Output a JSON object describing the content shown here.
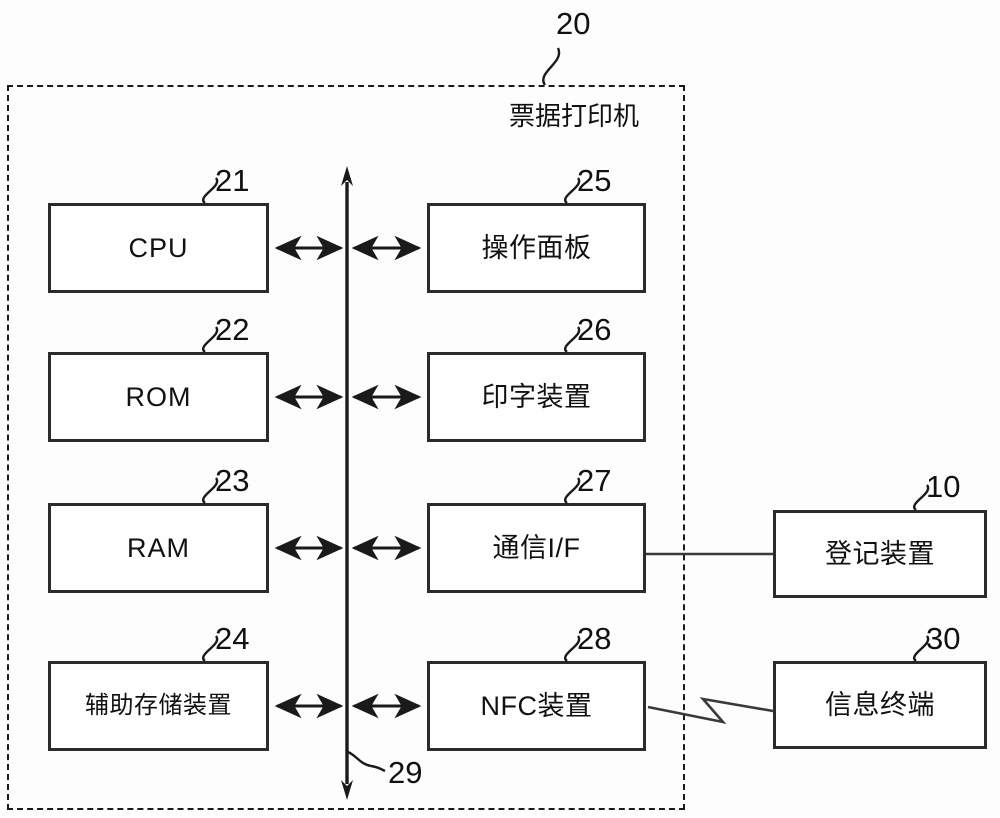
{
  "diagram": {
    "enclosure": {
      "title": "票据打印机",
      "ref": "20"
    },
    "bus": {
      "ref": "29"
    },
    "blocks": [
      {
        "id": "cpu",
        "label": "CPU",
        "ref": "21",
        "column": "left",
        "row": 1
      },
      {
        "id": "rom",
        "label": "ROM",
        "ref": "22",
        "column": "left",
        "row": 2
      },
      {
        "id": "ram",
        "label": "RAM",
        "ref": "23",
        "column": "left",
        "row": 3
      },
      {
        "id": "aux",
        "label": "辅助存储装置",
        "ref": "24",
        "column": "left",
        "row": 4
      },
      {
        "id": "panel",
        "label": "操作面板",
        "ref": "25",
        "column": "mid",
        "row": 1
      },
      {
        "id": "printer",
        "label": "印字装置",
        "ref": "26",
        "column": "mid",
        "row": 2
      },
      {
        "id": "commif",
        "label": "通信I/F",
        "ref": "27",
        "column": "mid",
        "row": 3
      },
      {
        "id": "nfc",
        "label": "NFC装置",
        "ref": "28",
        "column": "mid",
        "row": 4
      },
      {
        "id": "reg",
        "label": "登记装置",
        "ref": "10",
        "column": "right",
        "row": 3
      },
      {
        "id": "term",
        "label": "信息终端",
        "ref": "30",
        "column": "right",
        "row": 4
      }
    ],
    "connections": [
      {
        "from": "cpu",
        "to": "bus",
        "style": "double-arrow"
      },
      {
        "from": "bus",
        "to": "panel",
        "style": "double-arrow"
      },
      {
        "from": "rom",
        "to": "bus",
        "style": "double-arrow"
      },
      {
        "from": "bus",
        "to": "printer",
        "style": "double-arrow"
      },
      {
        "from": "ram",
        "to": "bus",
        "style": "double-arrow"
      },
      {
        "from": "bus",
        "to": "commif",
        "style": "double-arrow"
      },
      {
        "from": "aux",
        "to": "bus",
        "style": "double-arrow"
      },
      {
        "from": "bus",
        "to": "nfc",
        "style": "double-arrow"
      },
      {
        "from": "commif",
        "to": "reg",
        "style": "solid-line"
      },
      {
        "from": "nfc",
        "to": "term",
        "style": "wireless-zigzag"
      }
    ],
    "colors": {
      "stroke": "#2b2b2b",
      "dashed": "#1a1a1a",
      "background": "#fdfdfd",
      "text": "#111111"
    }
  }
}
